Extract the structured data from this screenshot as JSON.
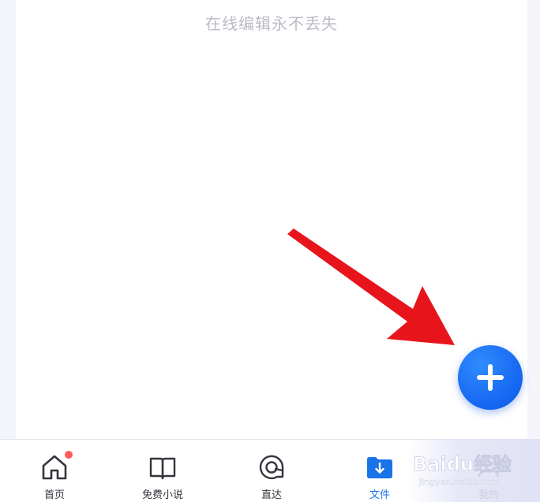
{
  "content": {
    "hint_text": "在线编辑永不丢失"
  },
  "fab": {
    "icon": "plus-icon",
    "color": "#1565f0"
  },
  "annotation": {
    "arrow_color": "#e8141c"
  },
  "tabbar": {
    "tabs": [
      {
        "label": "首页",
        "icon": "home-icon",
        "badge": true
      },
      {
        "label": "免费小说",
        "icon": "book-icon"
      },
      {
        "label": "直达",
        "icon": "direct-icon"
      },
      {
        "label": "文件",
        "icon": "folder-download-icon",
        "active": true,
        "color": "#1a73e8"
      },
      {
        "label": "我的",
        "icon": "profile-icon"
      }
    ]
  },
  "watermark": {
    "text": "Baidu经验",
    "url_text": "jingyan.baidu.com"
  }
}
